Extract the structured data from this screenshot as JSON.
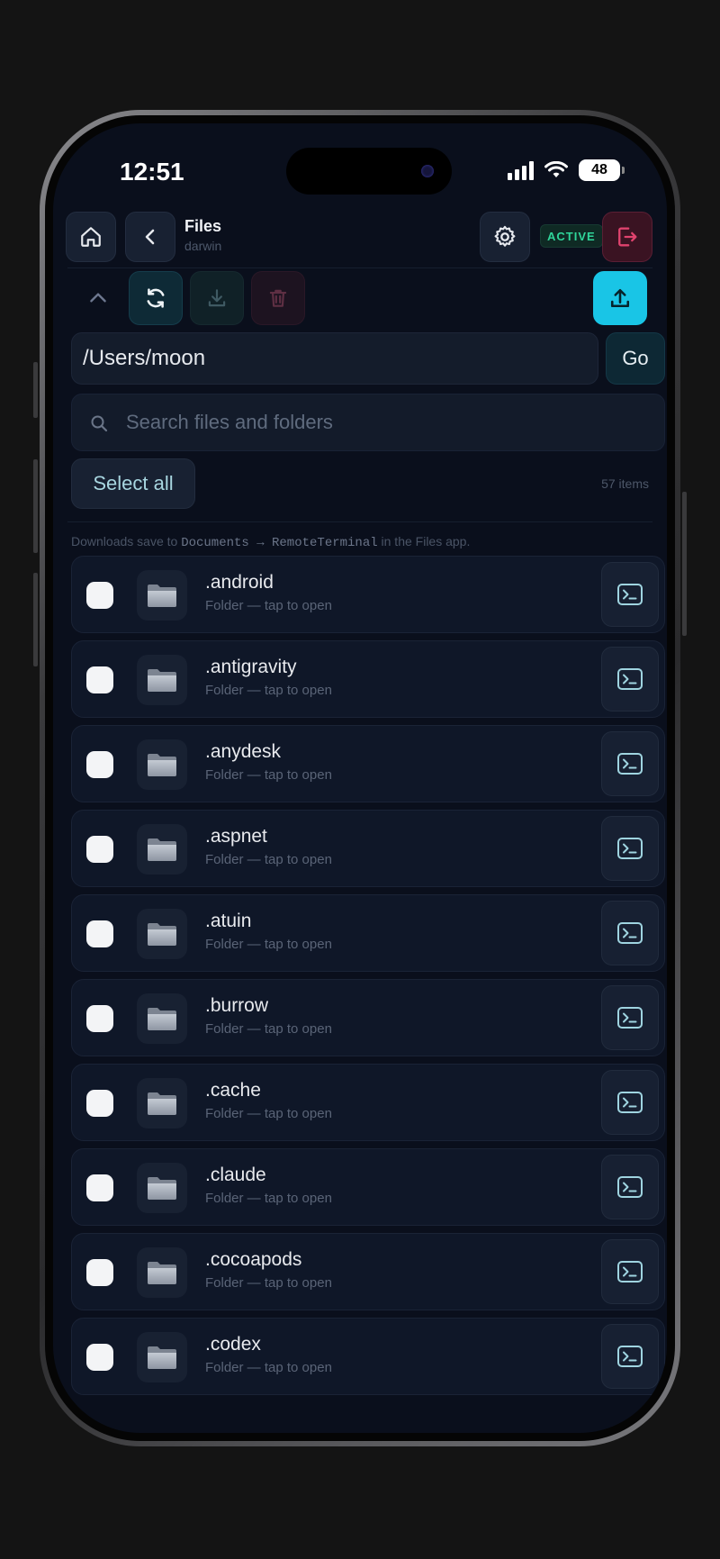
{
  "status_bar": {
    "time": "12:51",
    "battery": "48"
  },
  "header": {
    "title": "Files",
    "subtitle": "darwin",
    "status_badge": "ACTIVE"
  },
  "path": {
    "value": "/Users/moon",
    "go_label": "Go"
  },
  "search": {
    "placeholder": "Search files and folders"
  },
  "selection": {
    "select_all_label": "Select all",
    "items_count": "57 items"
  },
  "info": {
    "prefix": "Downloads save to",
    "folder_path": "Documents → RemoteTerminal",
    "suffix": "in the Files app."
  },
  "icons": {
    "home": "home-icon",
    "back": "chevron-left-icon",
    "settings": "gear-icon",
    "logout": "logout-icon",
    "collapse": "chevron-up-icon",
    "refresh": "refresh-icon",
    "download": "download-icon",
    "delete": "trash-icon",
    "upload": "upload-icon",
    "search": "search-icon",
    "folder": "folder-icon",
    "terminal": "terminal-icon"
  },
  "colors": {
    "accent": "#19c5e6",
    "active_badge": "#2fd59a",
    "logout": "#e0436e",
    "background": "#0a0f1c"
  },
  "files": [
    {
      "name": ".android",
      "subtitle": "Folder — tap to open"
    },
    {
      "name": ".antigravity",
      "subtitle": "Folder — tap to open"
    },
    {
      "name": ".anydesk",
      "subtitle": "Folder — tap to open"
    },
    {
      "name": ".aspnet",
      "subtitle": "Folder — tap to open"
    },
    {
      "name": ".atuin",
      "subtitle": "Folder — tap to open"
    },
    {
      "name": ".burrow",
      "subtitle": "Folder — tap to open"
    },
    {
      "name": ".cache",
      "subtitle": "Folder — tap to open"
    },
    {
      "name": ".claude",
      "subtitle": "Folder — tap to open"
    },
    {
      "name": ".cocoapods",
      "subtitle": "Folder — tap to open"
    },
    {
      "name": ".codex",
      "subtitle": "Folder — tap to open"
    }
  ]
}
